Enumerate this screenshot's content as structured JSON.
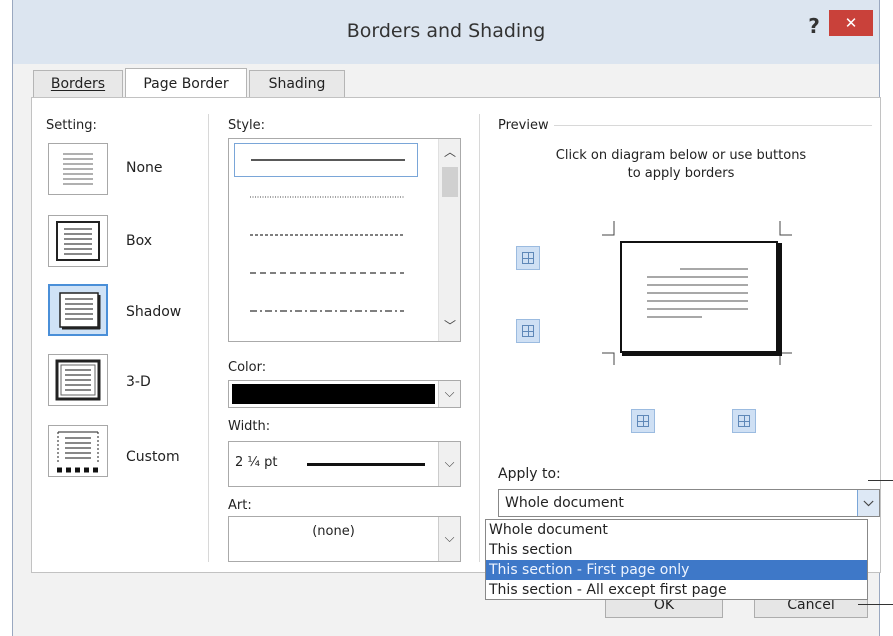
{
  "dialog": {
    "title": "Borders and Shading",
    "help_label": "?",
    "close_label": "✕"
  },
  "tabs": [
    {
      "label": "Borders",
      "active": false
    },
    {
      "label": "Page Border",
      "active": true
    },
    {
      "label": "Shading",
      "active": false
    }
  ],
  "setting": {
    "label": "Setting:",
    "items": [
      {
        "label": "None",
        "icon": "setting-none-icon",
        "selected": false
      },
      {
        "label": "Box",
        "icon": "setting-box-icon",
        "selected": false
      },
      {
        "label": "Shadow",
        "icon": "setting-shadow-icon",
        "selected": true
      },
      {
        "label": "3-D",
        "icon": "setting-3d-icon",
        "selected": false
      },
      {
        "label": "Custom",
        "icon": "setting-custom-icon",
        "selected": false
      }
    ]
  },
  "style": {
    "label": "Style:",
    "options": [
      "solid",
      "dotted",
      "dense-dashed",
      "dashed",
      "dash-dot"
    ],
    "selected_index": 0
  },
  "color": {
    "label": "Color:",
    "value_hex": "#000000"
  },
  "width": {
    "label": "Width:",
    "value": "2 ¼ pt"
  },
  "art": {
    "label": "Art:",
    "value": "(none)"
  },
  "preview": {
    "label": "Preview",
    "instruction_line1": "Click on diagram below or use buttons",
    "instruction_line2": "to apply borders"
  },
  "apply_to": {
    "label": "Apply to:",
    "value": "Whole document",
    "options": [
      "Whole document",
      "This section",
      "This section - First page only",
      "This section - All except first page"
    ],
    "highlighted_index": 2
  },
  "buttons": {
    "ok_label": "OK",
    "cancel_label": "Cancel"
  },
  "colors": {
    "accent": "#3e78c8",
    "close": "#c9413a",
    "titlebar": "#dce5f0"
  }
}
